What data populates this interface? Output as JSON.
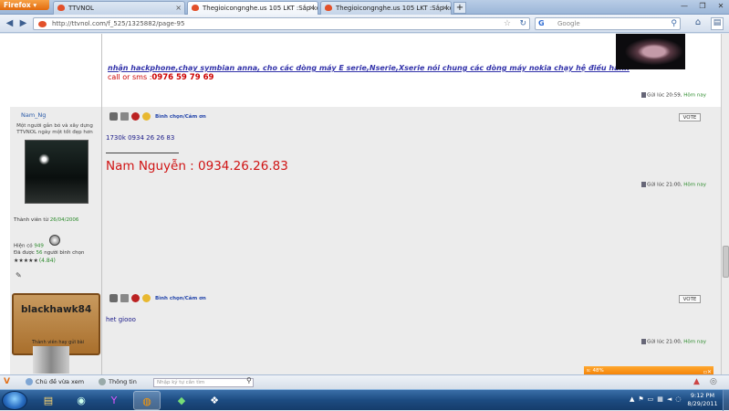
{
  "browser": {
    "app_button": "Firefox",
    "tabs": [
      {
        "label": "TTVNOL",
        "active": false
      },
      {
        "label": "Thegioicongnghe.us 105 LKT :Sắp kết...",
        "active": true
      },
      {
        "label": "Thegioicongnghe.us 105 LKT :Sắp kết...",
        "active": false
      }
    ],
    "new_tab": "+",
    "url": "http://ttvnol.com/f_525/1325882/page-95",
    "search_placeholder": "Google",
    "search_engine": "G"
  },
  "posts": [
    {
      "signature_line1": "nhận hackphone,chạy symbian anna, cho các dòng máy E serie,Nserie,Xserie nói chung các dòng máy nokia chạy hệ điều hành",
      "signature_line2_prefix": "call or sms :",
      "signature_line2_phone": "0976 59 79 69",
      "time_prefix": "Gửi lúc 20:59, ",
      "time_suffix": "Hôm nay"
    },
    {
      "username": "Nam_Ng",
      "user_title": "Một người gắn bó và xây dựng TTVNOL ngày một tốt đẹp hơn",
      "joined_label": "Thành viên từ ",
      "joined_date": "26/04/2006",
      "online_label": "Hiện có ",
      "online_count": "949",
      "voted_label": "Đã được ",
      "voted_count": "56",
      "voted_suffix": " người bình chọn",
      "stars": "★★★★★",
      "rating": "(4.84)",
      "vote_label": "Bình chọn/Cảm ơn",
      "vote_button": "VOTE",
      "message": "1730k 0934 26 26 83",
      "signature": "Nam Nguyễn : 0934.26.26.83",
      "time_prefix": "Gửi lúc 21:00, ",
      "time_suffix": "Hôm nay"
    },
    {
      "username": "blackhawk84",
      "user_title": "Thành viên hay gửi bài",
      "vote_label": "Bình chọn/Cảm ơn",
      "vote_button": "VOTE",
      "message": "het giooo",
      "time_prefix": "Gửi lúc 21:00, ",
      "time_suffix": "Hôm nay"
    }
  ],
  "findbar": {
    "item1": "Chủ đề vừa xem",
    "item2": "Thông tin",
    "input_placeholder": "Nhập ký tự cần tìm",
    "notification": "s: 48%"
  },
  "taskbar": {
    "time": "9:12 PM",
    "date": "8/29/2011"
  }
}
